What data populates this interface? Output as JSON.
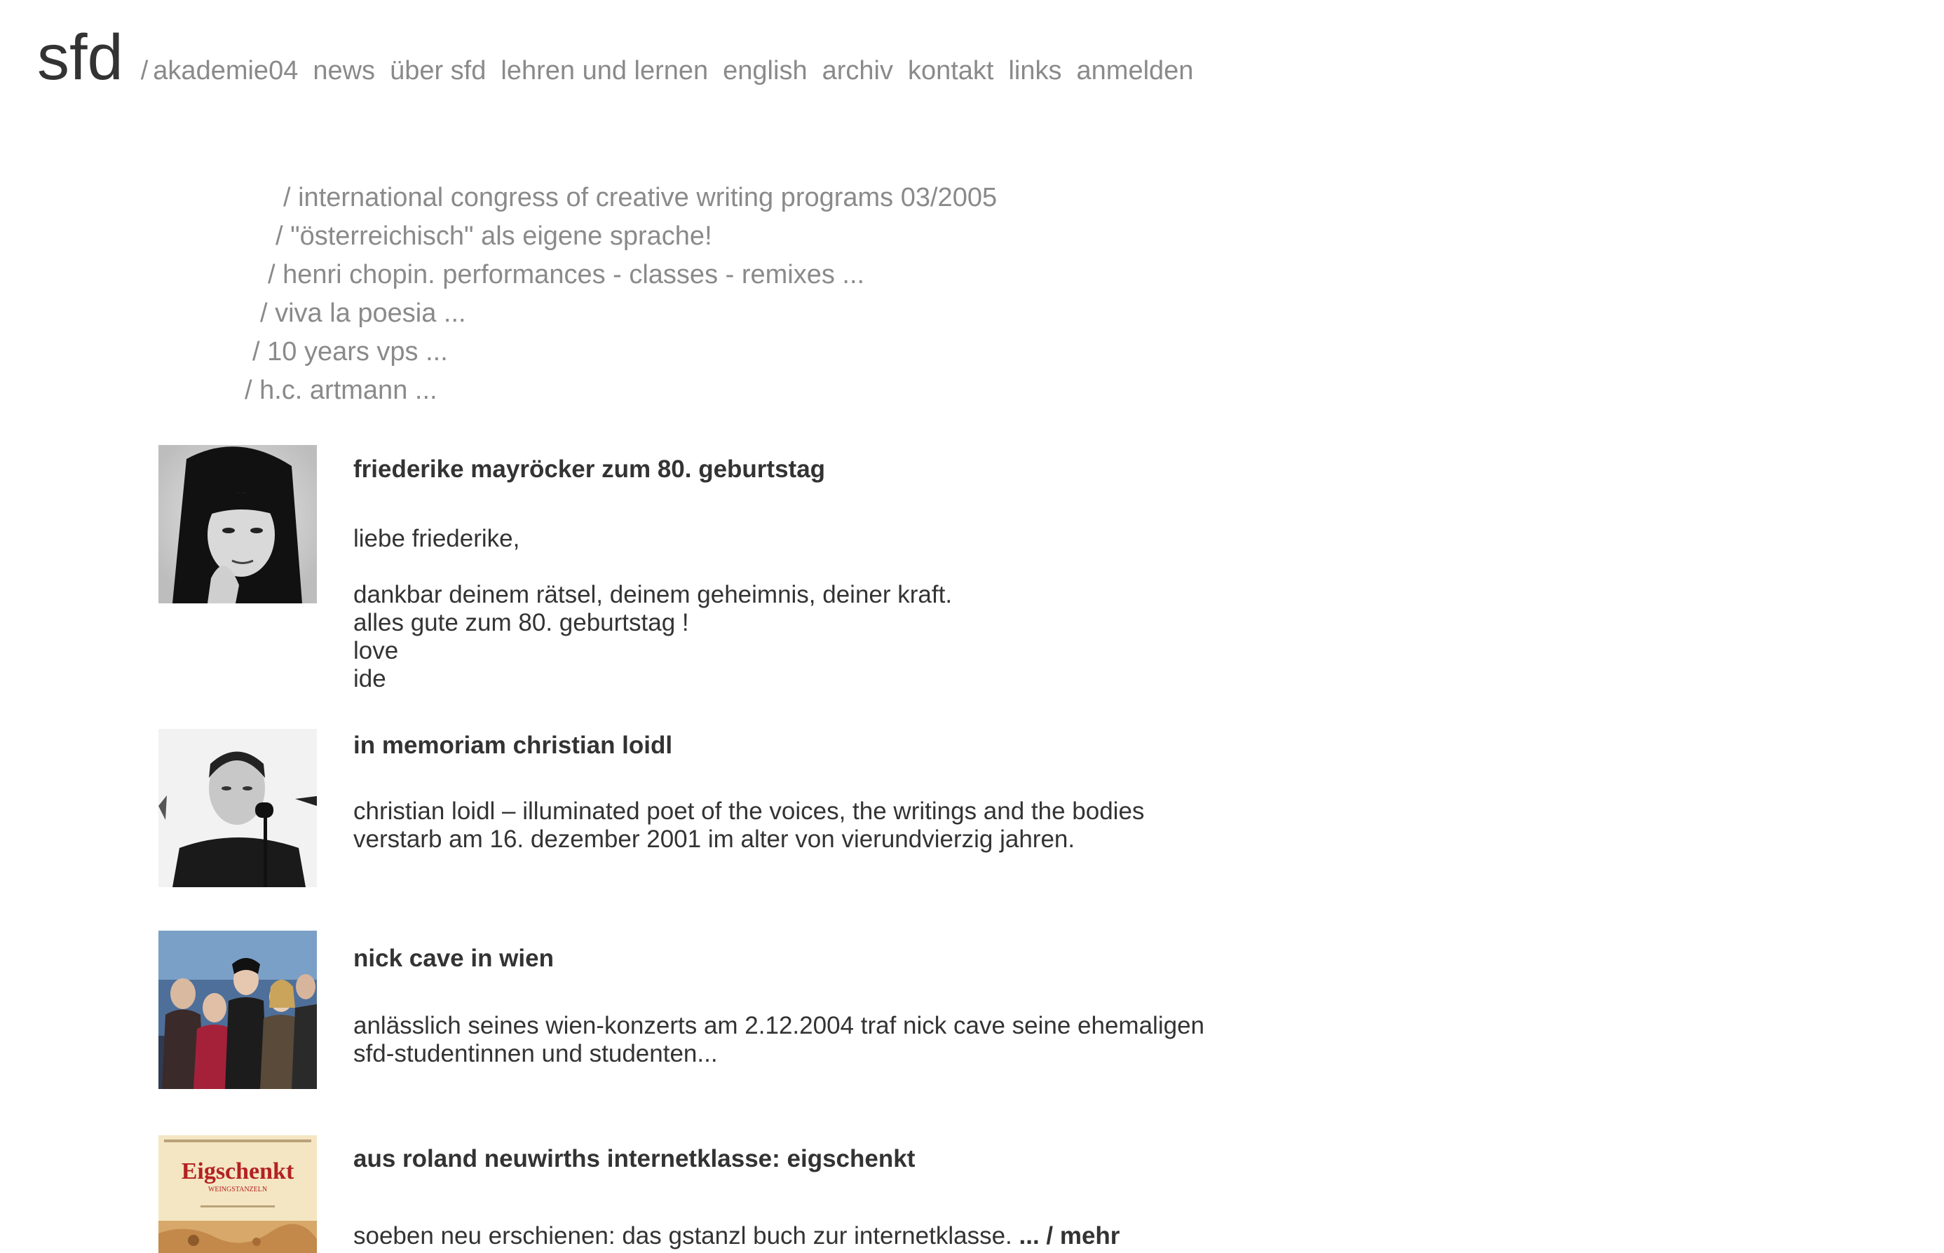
{
  "site": {
    "logo": "sfd",
    "separator": "/"
  },
  "nav": {
    "items": [
      {
        "label": "akademie04"
      },
      {
        "label": "news"
      },
      {
        "label": "über sfd"
      },
      {
        "label": "lehren und lernen"
      },
      {
        "label": "english"
      },
      {
        "label": "archiv"
      },
      {
        "label": "kontakt"
      },
      {
        "label": "links"
      },
      {
        "label": "anmelden"
      }
    ]
  },
  "features": [
    {
      "label": "/ international congress of creative writing programs 03/2005"
    },
    {
      "label": "/ \"österreichisch\" als eigene sprache!"
    },
    {
      "label": "/ henri chopin. performances - classes - remixes ..."
    },
    {
      "label": "/ viva la poesia ..."
    },
    {
      "label": "/ 10 years vps ..."
    },
    {
      "label": "/ h.c. artmann ..."
    }
  ],
  "articles": [
    {
      "title": "friederike mayröcker zum 80. geburtstag",
      "lines": [
        "liebe friederike,",
        "dankbar deinem rätsel, deinem geheimnis, deiner kraft.",
        "alles gute zum 80. geburtstag !",
        "love",
        "ide"
      ],
      "image": "portrait-photo"
    },
    {
      "title": "in memoriam christian loidl",
      "lines": [
        "christian loidl – illuminated poet of the voices, the writings and the bodies",
        "verstarb am 16. dezember 2001 im alter von vierundvierzig jahren."
      ],
      "image": "performer-photo"
    },
    {
      "title": "nick cave in wien",
      "lines": [
        "anlässlich seines wien-konzerts am 2.12.2004 traf nick cave seine ehemaligen",
        "sfd-studentinnen und studenten..."
      ],
      "image": "group-photo"
    },
    {
      "title": "aus roland neuwirths internetklasse: eigschenkt",
      "lines": [
        "soeben neu erschienen: das gstanzl buch zur internetklasse."
      ],
      "more_label": "... / mehr",
      "image": "book-cover",
      "cover_title": "Eigschenkt",
      "cover_subtitle": "WEINGSTANZELN"
    }
  ]
}
